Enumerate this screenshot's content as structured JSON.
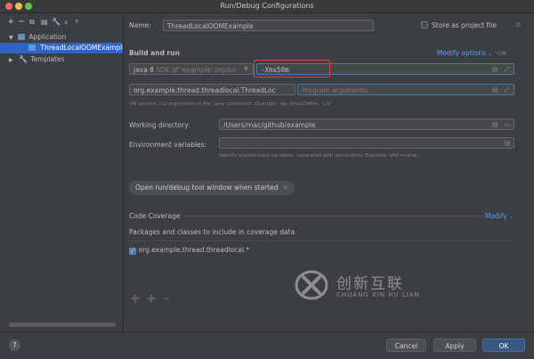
{
  "window": {
    "title": "Run/Debug Configurations"
  },
  "toolbar": {
    "add": "+",
    "remove": "−",
    "copy": "⧉",
    "save": "▤",
    "edit": "🔧",
    "move_up": "▲",
    "move_down": "▼"
  },
  "tree": {
    "application_label": "Application",
    "config_item_label": "ThreadLocalOOMExample",
    "templates_label": "Templates"
  },
  "form": {
    "name_label": "Name:",
    "name_value": "ThreadLocalOOMExample",
    "store_label": "Store as project file",
    "build_run_label": "Build and run",
    "modify_options_label": "Modify options",
    "modify_options_shortcut": "⌥M",
    "jdk_value": "java 8",
    "jdk_hint": "SDK of 'example' modul",
    "vm_options_value": "-Xmx50m",
    "main_class_value": "org.example.thread.threadlocal.ThreadLoc",
    "program_args_placeholder": "Program arguments",
    "vm_hint": "VM options. CLI arguments to the 'java' command. Example: -ea -Xmx2048m. ⌥V",
    "working_dir_label": "Working directory:",
    "working_dir_value": "/Users/mac/github/example",
    "env_label": "Environment variables:",
    "env_hint": "Specify environment variables, separated with semicolons. Example: VAR=value",
    "open_tool_window_chip": "Open run/debug tool window when started",
    "code_coverage_label": "Code Coverage",
    "modify_label": "Modify",
    "packages_label": "Packages and classes to include in coverage data",
    "coverage_item": "org.example.thread.threadlocal.*"
  },
  "buttons": {
    "help": "?",
    "cancel": "Cancel",
    "apply": "Apply",
    "ok": "OK"
  },
  "watermark": {
    "text": "创新互联",
    "sub": "CHUANG XIN HU LIAN"
  },
  "colors": {
    "accent": "#589df6",
    "selection": "#2f65ca",
    "highlight_box": "#e0413c",
    "primary_button": "#365880"
  }
}
